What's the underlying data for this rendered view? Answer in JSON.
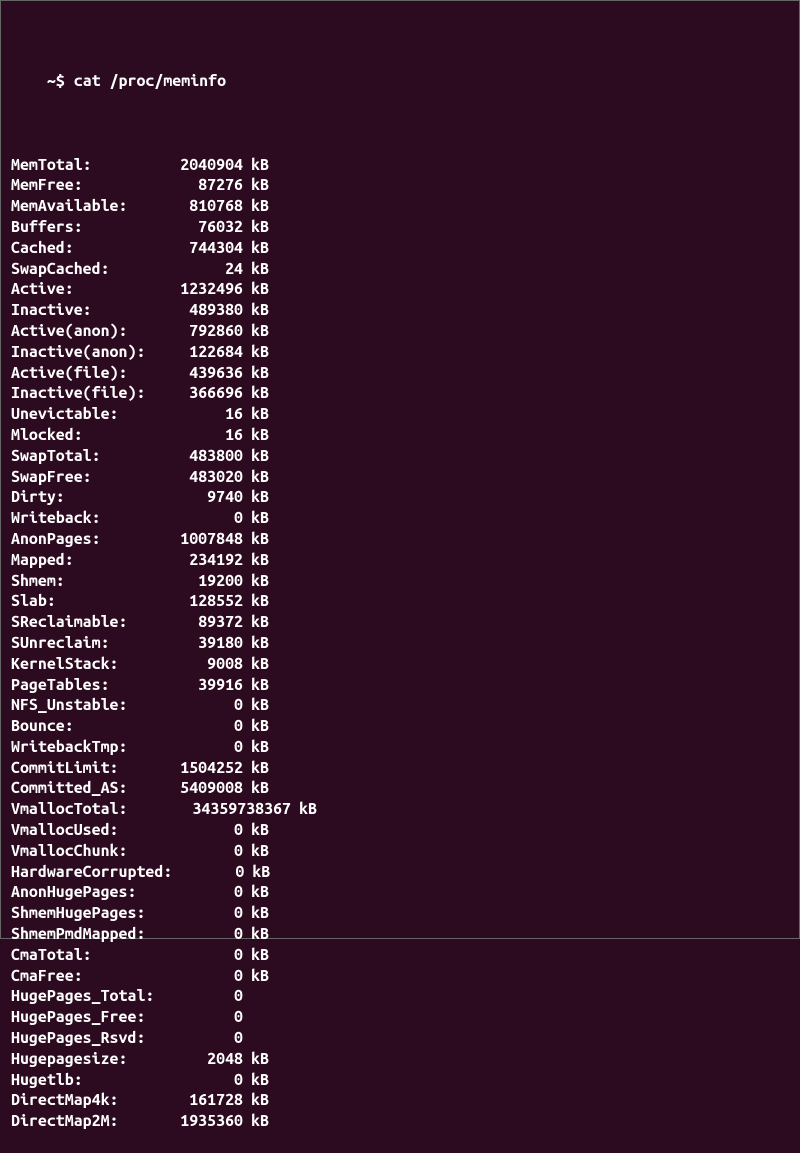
{
  "prompt": "~$",
  "command": "cat /proc/meminfo",
  "entries": [
    {
      "label": "MemTotal:",
      "value": "2040904",
      "unit": "kB"
    },
    {
      "label": "MemFree:",
      "value": "87276",
      "unit": "kB"
    },
    {
      "label": "MemAvailable:",
      "value": "810768",
      "unit": "kB"
    },
    {
      "label": "Buffers:",
      "value": "76032",
      "unit": "kB"
    },
    {
      "label": "Cached:",
      "value": "744304",
      "unit": "kB"
    },
    {
      "label": "SwapCached:",
      "value": "24",
      "unit": "kB"
    },
    {
      "label": "Active:",
      "value": "1232496",
      "unit": "kB"
    },
    {
      "label": "Inactive:",
      "value": "489380",
      "unit": "kB"
    },
    {
      "label": "Active(anon):",
      "value": "792860",
      "unit": "kB"
    },
    {
      "label": "Inactive(anon):",
      "value": "122684",
      "unit": "kB"
    },
    {
      "label": "Active(file):",
      "value": "439636",
      "unit": "kB"
    },
    {
      "label": "Inactive(file):",
      "value": "366696",
      "unit": "kB"
    },
    {
      "label": "Unevictable:",
      "value": "16",
      "unit": "kB"
    },
    {
      "label": "Mlocked:",
      "value": "16",
      "unit": "kB"
    },
    {
      "label": "SwapTotal:",
      "value": "483800",
      "unit": "kB"
    },
    {
      "label": "SwapFree:",
      "value": "483020",
      "unit": "kB"
    },
    {
      "label": "Dirty:",
      "value": "9740",
      "unit": "kB"
    },
    {
      "label": "Writeback:",
      "value": "0",
      "unit": "kB"
    },
    {
      "label": "AnonPages:",
      "value": "1007848",
      "unit": "kB"
    },
    {
      "label": "Mapped:",
      "value": "234192",
      "unit": "kB"
    },
    {
      "label": "Shmem:",
      "value": "19200",
      "unit": "kB"
    },
    {
      "label": "Slab:",
      "value": "128552",
      "unit": "kB"
    },
    {
      "label": "SReclaimable:",
      "value": "89372",
      "unit": "kB"
    },
    {
      "label": "SUnreclaim:",
      "value": "39180",
      "unit": "kB"
    },
    {
      "label": "KernelStack:",
      "value": "9008",
      "unit": "kB"
    },
    {
      "label": "PageTables:",
      "value": "39916",
      "unit": "kB"
    },
    {
      "label": "NFS_Unstable:",
      "value": "0",
      "unit": "kB"
    },
    {
      "label": "Bounce:",
      "value": "0",
      "unit": "kB"
    },
    {
      "label": "WritebackTmp:",
      "value": "0",
      "unit": "kB"
    },
    {
      "label": "CommitLimit:",
      "value": "1504252",
      "unit": "kB"
    },
    {
      "label": "Committed_AS:",
      "value": "5409008",
      "unit": "kB"
    },
    {
      "label": "VmallocTotal:",
      "value": "34359738367",
      "unit": "kB",
      "wide": true
    },
    {
      "label": "VmallocUsed:",
      "value": "0",
      "unit": "kB"
    },
    {
      "label": "VmallocChunk:",
      "value": "0",
      "unit": "kB"
    },
    {
      "label": "HardwareCorrupted:",
      "value": "0",
      "unit": "kB"
    },
    {
      "label": "AnonHugePages:",
      "value": "0",
      "unit": "kB"
    },
    {
      "label": "ShmemHugePages:",
      "value": "0",
      "unit": "kB"
    },
    {
      "label": "ShmemPmdMapped:",
      "value": "0",
      "unit": "kB"
    },
    {
      "label": "CmaTotal:",
      "value": "0",
      "unit": "kB"
    },
    {
      "label": "CmaFree:",
      "value": "0",
      "unit": "kB"
    },
    {
      "label": "HugePages_Total:",
      "value": "0",
      "unit": ""
    },
    {
      "label": "HugePages_Free:",
      "value": "0",
      "unit": ""
    },
    {
      "label": "HugePages_Rsvd:",
      "value": "0",
      "unit": ""
    },
    {
      "label": "Hugepagesize:",
      "value": "2048",
      "unit": "kB"
    },
    {
      "label": "Hugetlb:",
      "value": "0",
      "unit": "kB"
    },
    {
      "label": "DirectMap4k:",
      "value": "161728",
      "unit": "kB"
    },
    {
      "label": "DirectMap2M:",
      "value": "1935360",
      "unit": "kB"
    }
  ]
}
